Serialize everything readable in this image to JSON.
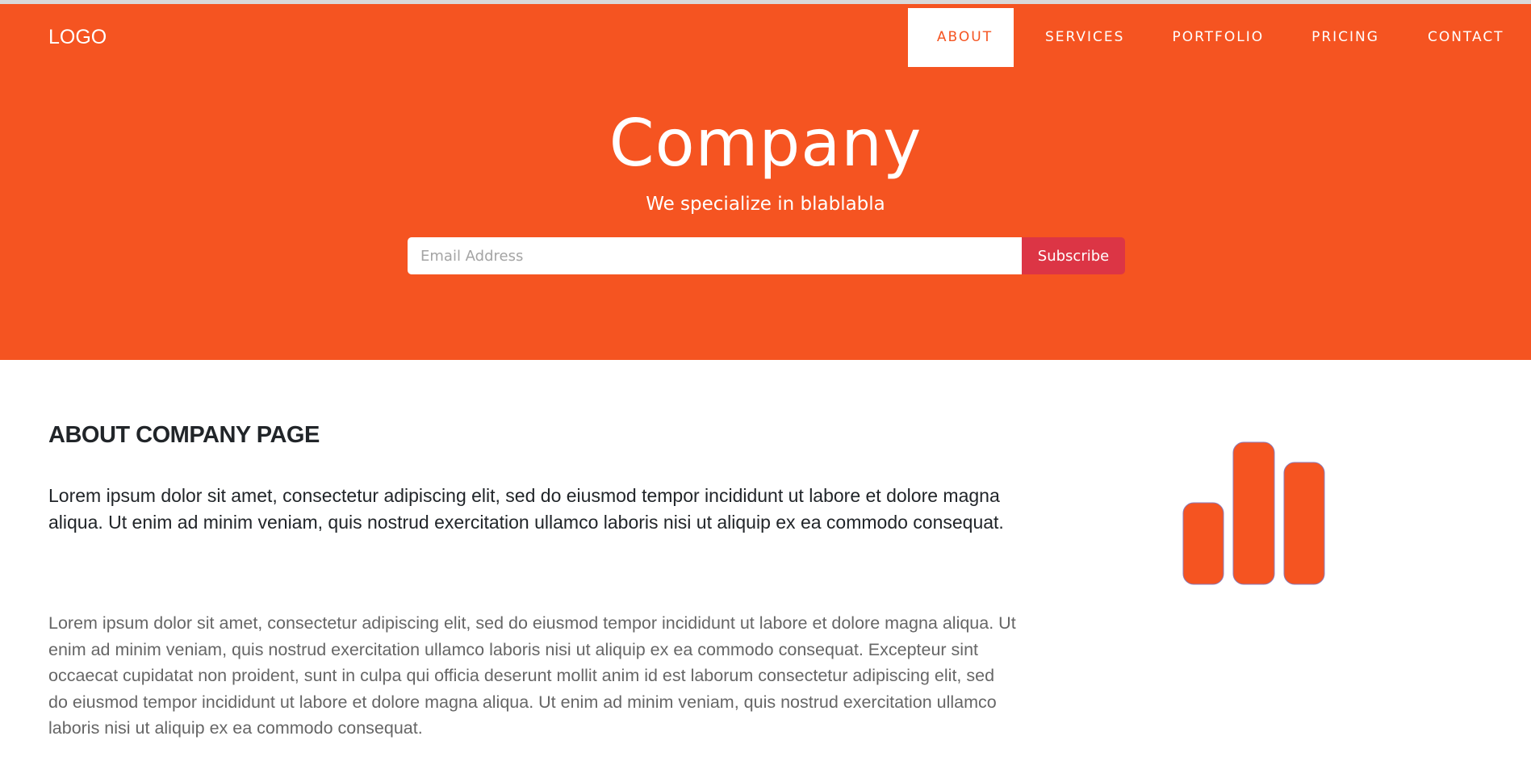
{
  "header": {
    "logo": "LOGO",
    "nav": [
      {
        "label": "ABOUT",
        "active": true
      },
      {
        "label": "SERVICES",
        "active": false
      },
      {
        "label": "PORTFOLIO",
        "active": false
      },
      {
        "label": "PRICING",
        "active": false
      },
      {
        "label": "CONTACT",
        "active": false
      }
    ]
  },
  "hero": {
    "title": "Company",
    "subtitle": "We specialize in blablabla",
    "email_placeholder": "Email Address",
    "subscribe_label": "Subscribe"
  },
  "about": {
    "title": "ABOUT COMPANY PAGE",
    "lead": "Lorem ipsum dolor sit amet, consectetur adipiscing elit, sed do eiusmod tempor incididunt ut labore et dolore magna aliqua. Ut enim ad minim veniam, quis nostrud exercitation ullamco laboris nisi ut aliquip ex ea commodo consequat.",
    "body": "Lorem ipsum dolor sit amet, consectetur adipiscing elit, sed do eiusmod tempor incididunt ut labore et dolore magna aliqua. Ut enim ad minim veniam, quis nostrud exercitation ullamco laboris nisi ut aliquip ex ea commodo consequat. Excepteur sint occaecat cupidatat non proident, sunt in culpa qui officia deserunt mollit anim id est laborum consectetur adipiscing elit, sed do eiusmod tempor incididunt ut labore et dolore magna aliqua. Ut enim ad minim veniam, quis nostrud exercitation ullamco laboris nisi ut aliquip ex ea commodo consequat.",
    "icon": "bar-chart-icon"
  },
  "colors": {
    "primary": "#f55421",
    "subscribe_button": "#dc3545",
    "heading_text": "#212529",
    "body_text": "#666666"
  }
}
